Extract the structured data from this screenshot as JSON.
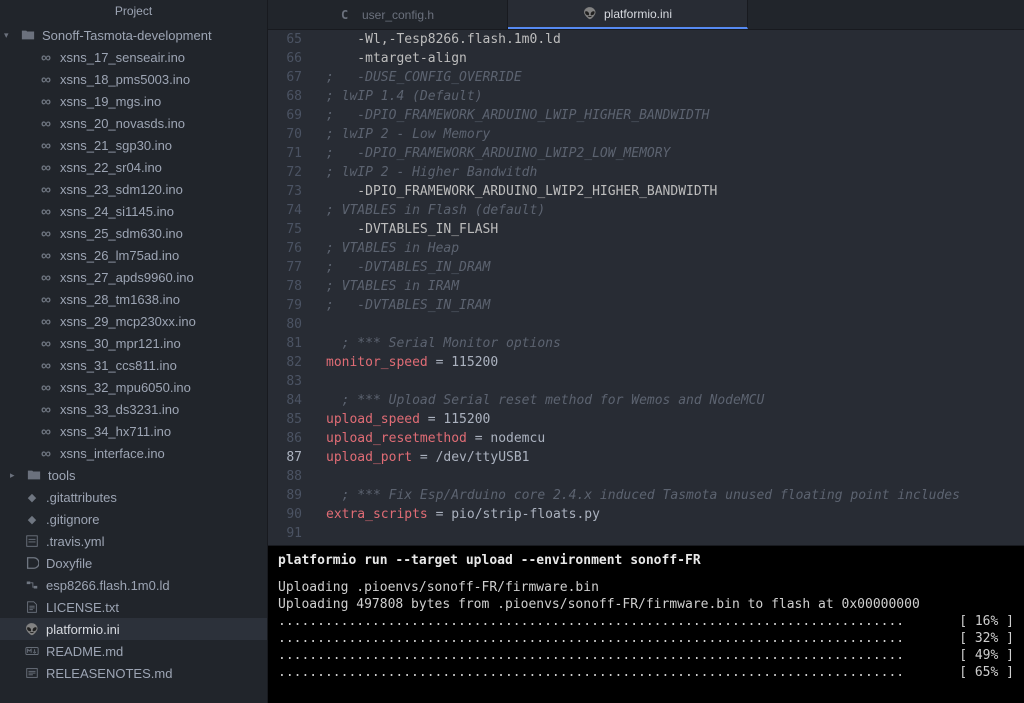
{
  "sidebar": {
    "header": "Project",
    "root": "Sonoff-Tasmota-development",
    "ino_files": [
      "xsns_17_senseair.ino",
      "xsns_18_pms5003.ino",
      "xsns_19_mgs.ino",
      "xsns_20_novasds.ino",
      "xsns_21_sgp30.ino",
      "xsns_22_sr04.ino",
      "xsns_23_sdm120.ino",
      "xsns_24_si1145.ino",
      "xsns_25_sdm630.ino",
      "xsns_26_lm75ad.ino",
      "xsns_27_apds9960.ino",
      "xsns_28_tm1638.ino",
      "xsns_29_mcp230xx.ino",
      "xsns_30_mpr121.ino",
      "xsns_31_ccs811.ino",
      "xsns_32_mpu6050.ino",
      "xsns_33_ds3231.ino",
      "xsns_34_hx711.ino",
      "xsns_interface.ino"
    ],
    "tools_folder": "tools",
    "misc_files": [
      {
        "name": ".gitattributes",
        "icon": "git"
      },
      {
        "name": ".gitignore",
        "icon": "git"
      },
      {
        "name": ".travis.yml",
        "icon": "yml"
      },
      {
        "name": "Doxyfile",
        "icon": "doxy"
      },
      {
        "name": "esp8266.flash.1m0.ld",
        "icon": "ld"
      },
      {
        "name": "LICENSE.txt",
        "icon": "txt"
      },
      {
        "name": "platformio.ini",
        "icon": "pio",
        "selected": true
      },
      {
        "name": "README.md",
        "icon": "md"
      },
      {
        "name": "RELEASENOTES.md",
        "icon": "rn"
      }
    ]
  },
  "tabs": [
    {
      "label": "user_config.h",
      "icon": "c",
      "active": false
    },
    {
      "label": "platformio.ini",
      "icon": "pio",
      "active": true
    }
  ],
  "code": [
    {
      "n": 65,
      "segs": [
        [
          "plain",
          "    -Wl,-Tesp8266.flash.1m0.ld"
        ]
      ]
    },
    {
      "n": 66,
      "segs": [
        [
          "plain",
          "    -mtarget-align"
        ]
      ]
    },
    {
      "n": 67,
      "segs": [
        [
          "comment",
          ";   -DUSE_CONFIG_OVERRIDE"
        ]
      ]
    },
    {
      "n": 68,
      "segs": [
        [
          "comment",
          "; lwIP 1.4 (Default)"
        ]
      ]
    },
    {
      "n": 69,
      "segs": [
        [
          "comment",
          ";   -DPIO_FRAMEWORK_ARDUINO_LWIP_HIGHER_BANDWIDTH"
        ]
      ]
    },
    {
      "n": 70,
      "segs": [
        [
          "comment",
          "; lwIP 2 - Low Memory"
        ]
      ]
    },
    {
      "n": 71,
      "segs": [
        [
          "comment",
          ";   -DPIO_FRAMEWORK_ARDUINO_LWIP2_LOW_MEMORY"
        ]
      ]
    },
    {
      "n": 72,
      "segs": [
        [
          "comment",
          "; lwIP 2 - Higher Bandwitdh"
        ]
      ]
    },
    {
      "n": 73,
      "segs": [
        [
          "plain",
          "    -DPIO_FRAMEWORK_ARDUINO_LWIP2_HIGHER_BANDWIDTH"
        ]
      ]
    },
    {
      "n": 74,
      "segs": [
        [
          "comment",
          "; VTABLES in Flash (default)"
        ]
      ]
    },
    {
      "n": 75,
      "segs": [
        [
          "plain",
          "    -DVTABLES_IN_FLASH"
        ]
      ]
    },
    {
      "n": 76,
      "segs": [
        [
          "comment",
          "; VTABLES in Heap"
        ]
      ]
    },
    {
      "n": 77,
      "segs": [
        [
          "comment",
          ";   -DVTABLES_IN_DRAM"
        ]
      ]
    },
    {
      "n": 78,
      "segs": [
        [
          "comment",
          "; VTABLES in IRAM"
        ]
      ]
    },
    {
      "n": 79,
      "segs": [
        [
          "comment",
          ";   -DVTABLES_IN_IRAM"
        ]
      ]
    },
    {
      "n": 80,
      "segs": []
    },
    {
      "n": 81,
      "segs": [
        [
          "comment",
          "  ; *** Serial Monitor options"
        ]
      ]
    },
    {
      "n": 82,
      "segs": [
        [
          "key",
          "monitor_speed"
        ],
        [
          "punct",
          " = "
        ],
        [
          "value",
          "115200"
        ]
      ]
    },
    {
      "n": 83,
      "segs": []
    },
    {
      "n": 84,
      "segs": [
        [
          "comment",
          "  ; *** Upload Serial reset method for Wemos and NodeMCU"
        ]
      ]
    },
    {
      "n": 85,
      "segs": [
        [
          "key",
          "upload_speed"
        ],
        [
          "punct",
          " = "
        ],
        [
          "value",
          "115200"
        ]
      ]
    },
    {
      "n": 86,
      "segs": [
        [
          "key",
          "upload_resetmethod"
        ],
        [
          "punct",
          " = "
        ],
        [
          "value",
          "nodemcu"
        ]
      ]
    },
    {
      "n": 87,
      "current": true,
      "segs": [
        [
          "key",
          "upload_port"
        ],
        [
          "punct",
          " = "
        ],
        [
          "value",
          "/dev/ttyUSB1"
        ]
      ]
    },
    {
      "n": 88,
      "segs": []
    },
    {
      "n": 89,
      "segs": [
        [
          "comment",
          "  ; *** Fix Esp/Arduino core 2.4.x induced Tasmota unused floating point includes"
        ]
      ]
    },
    {
      "n": 90,
      "segs": [
        [
          "key",
          "extra_scripts"
        ],
        [
          "punct",
          " = "
        ],
        [
          "value",
          "pio/strip-floats.py"
        ]
      ]
    },
    {
      "n": 91,
      "segs": []
    }
  ],
  "terminal": {
    "cmd": "platformio run --target upload --environment sonoff-FR",
    "line1": "Uploading .pioenvs/sonoff-FR/firmware.bin",
    "line2": "Uploading 497808 bytes from .pioenvs/sonoff-FR/firmware.bin to flash at 0x00000000",
    "progress": [
      "[ 16% ]",
      "[ 32% ]",
      "[ 49% ]",
      "[ 65% ]"
    ]
  }
}
